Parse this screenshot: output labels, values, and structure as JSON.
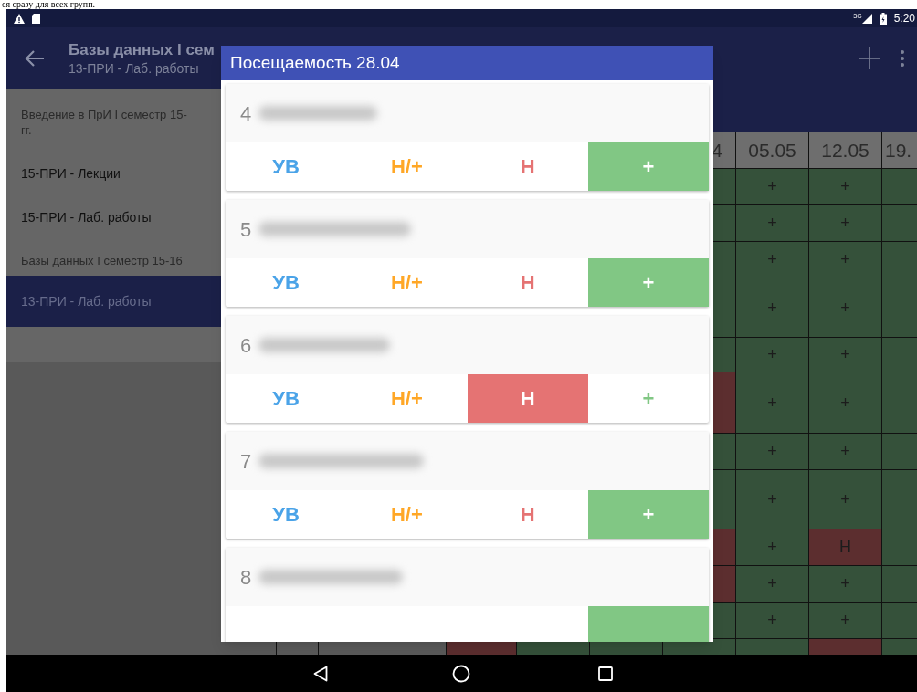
{
  "top_text": "ся сразу для всех групп.",
  "status_bar": {
    "network": "3G",
    "time": "5:20"
  },
  "app_bar": {
    "title": "Базы данных I сем",
    "subtitle": "13-ПРИ - Лаб. работы"
  },
  "sidebar": {
    "items": [
      {
        "kind": "header",
        "lines": [
          "Введение в ПрИ I семестр 15-",
          "гг."
        ]
      },
      {
        "kind": "item",
        "lines": [
          "15-ПРИ - Лекции"
        ],
        "selected": false
      },
      {
        "kind": "item",
        "lines": [
          "15-ПРИ - Лаб. работы"
        ],
        "selected": false
      },
      {
        "kind": "header",
        "lines": [
          "Базы данных I семестр 15-16"
        ]
      },
      {
        "kind": "item",
        "lines": [
          "13-ПРИ - Лаб. работы"
        ],
        "selected": true
      }
    ]
  },
  "table": {
    "columns": [
      "4",
      "05.05",
      "12.05",
      "19."
    ],
    "rows": [
      {
        "cells": [
          {
            "absent": false
          },
          {
            "text": "+",
            "absent": false
          },
          {
            "text": "+",
            "absent": false
          },
          {
            "absent": false
          }
        ]
      },
      {
        "cells": [
          {
            "absent": false
          },
          {
            "text": "+",
            "absent": false
          },
          {
            "text": "+",
            "absent": false
          },
          {
            "absent": false
          }
        ]
      },
      {
        "cells": [
          {
            "absent": false
          },
          {
            "text": "+",
            "absent": false
          },
          {
            "text": "+",
            "absent": false
          },
          {
            "absent": false
          }
        ]
      },
      {
        "cells": [
          {
            "absent": false
          },
          {
            "text": "+",
            "absent": false
          },
          {
            "text": "+",
            "absent": false
          },
          {
            "absent": false
          }
        ]
      },
      {
        "cells": [
          {
            "absent": false
          },
          {
            "text": "+",
            "absent": false
          },
          {
            "text": "+",
            "absent": false
          },
          {
            "absent": false
          }
        ]
      },
      {
        "cells": [
          {
            "absent": true
          },
          {
            "text": "+",
            "absent": false
          },
          {
            "text": "+",
            "absent": false
          },
          {
            "absent": false
          }
        ]
      },
      {
        "cells": [
          {
            "absent": false
          },
          {
            "text": "+",
            "absent": false
          },
          {
            "text": "+",
            "absent": false
          },
          {
            "absent": false
          }
        ]
      },
      {
        "cells": [
          {
            "absent": false
          },
          {
            "text": "+",
            "absent": false
          },
          {
            "text": "+",
            "absent": false
          },
          {
            "absent": false
          }
        ]
      },
      {
        "cells": [
          {
            "absent": true
          },
          {
            "text": "+",
            "absent": false
          },
          {
            "text": "Н",
            "absent": true
          },
          {
            "absent": false
          }
        ]
      },
      {
        "cells": [
          {
            "absent": true
          },
          {
            "text": "+",
            "absent": false
          },
          {
            "text": "+",
            "absent": false
          },
          {
            "absent": false
          }
        ]
      },
      {
        "cells": [
          {
            "absent": false
          },
          {
            "text": "+",
            "absent": false
          },
          {
            "text": "+",
            "absent": false
          },
          {
            "absent": false
          }
        ]
      },
      {
        "cells": [
          {
            "absent": true
          },
          {
            "absent": false
          },
          {
            "absent": false
          },
          {
            "absent": false
          },
          {
            "absent": false
          },
          {
            "absent": true
          },
          {
            "absent": false
          }
        ]
      }
    ]
  },
  "dialog": {
    "title": "Посещаемость 28.04",
    "students": [
      {
        "number": "4",
        "options": [
          {
            "kind": "excused",
            "label": "УВ",
            "selected": false
          },
          {
            "kind": "late",
            "label": "Н/+",
            "selected": false
          },
          {
            "kind": "absent",
            "label": "Н",
            "selected": false
          },
          {
            "kind": "present",
            "label": "+",
            "selected": true
          }
        ]
      },
      {
        "number": "5",
        "options": [
          {
            "kind": "excused",
            "label": "УВ",
            "selected": false
          },
          {
            "kind": "late",
            "label": "Н/+",
            "selected": false
          },
          {
            "kind": "absent",
            "label": "Н",
            "selected": false
          },
          {
            "kind": "present",
            "label": "+",
            "selected": true
          }
        ]
      },
      {
        "number": "6",
        "options": [
          {
            "kind": "excused",
            "label": "УВ",
            "selected": false
          },
          {
            "kind": "late",
            "label": "Н/+",
            "selected": false
          },
          {
            "kind": "absent",
            "label": "Н",
            "selected": true
          },
          {
            "kind": "present",
            "label": "+",
            "selected": false
          }
        ]
      },
      {
        "number": "7",
        "options": [
          {
            "kind": "excused",
            "label": "УВ",
            "selected": false
          },
          {
            "kind": "late",
            "label": "Н/+",
            "selected": false
          },
          {
            "kind": "absent",
            "label": "Н",
            "selected": false
          },
          {
            "kind": "present",
            "label": "+",
            "selected": true
          }
        ]
      },
      {
        "number": "8",
        "options": [
          {
            "kind": "present",
            "selected": true
          }
        ]
      }
    ]
  }
}
